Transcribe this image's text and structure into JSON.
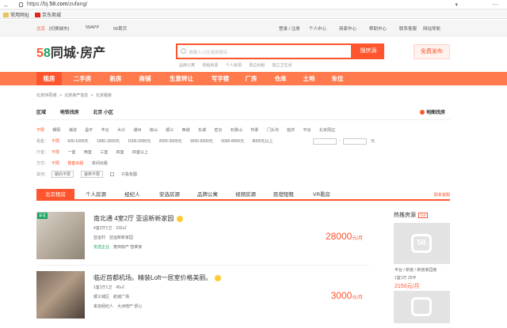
{
  "browser": {
    "url_prefix": "https://bj.",
    "url_domain": "58.com",
    "url_path": "/zufang/",
    "bookmarks": [
      "常用网址",
      "京东商城"
    ]
  },
  "topbar": {
    "city": "北京",
    "switch_city": "[切换城市]",
    "app": "58APP",
    "home": "58首页",
    "login": "登录 / 注册",
    "personal": "个人中心",
    "merchant": "商家中心",
    "help": "帮助中心",
    "service": "联系客服",
    "sitenav": "网站导航"
  },
  "header": {
    "logo_5": "5",
    "logo_8": "8",
    "logo_rest": "同城·房产",
    "search_placeholder": "请输入小区或商圈名",
    "search_button": "搜房源",
    "publish_button": "免费发布",
    "hot_keywords": [
      "品牌公寓",
      "热租房源",
      "个人房源",
      "周边出租",
      "独立卫生间"
    ]
  },
  "mainnav": [
    "租房",
    "二手房",
    "新房",
    "商铺",
    "生意转让",
    "写字楼",
    "厂房",
    "仓库",
    "土地",
    "车位"
  ],
  "breadcrumb": [
    "北京58同城",
    ">",
    "北京房产信息",
    ">",
    "北京租房"
  ],
  "areatabs": [
    "区域",
    "地铁找房",
    "北京 小区"
  ],
  "mapsearch": "地图找房",
  "filters": {
    "area": [
      "不限",
      "朝阳",
      "海淀",
      "昌平",
      "丰台",
      "大兴",
      "通州",
      "房山",
      "顺义",
      "西城",
      "东城",
      "密云",
      "石景山",
      "怀柔",
      "门头沟",
      "延庆",
      "平谷",
      "北京周边"
    ],
    "rent_label": "租金：",
    "rent": [
      "不限",
      "600-1000元",
      "1000-1500元",
      "1500-2000元",
      "2000-3000元",
      "3000-5000元",
      "5000-8000元",
      "8000元以上"
    ],
    "rent_unit": "元",
    "rooms_label": "厅室：",
    "rooms": [
      "不限",
      "一室",
      "两室",
      "三室",
      "四室",
      "四室以上"
    ],
    "type_label": "方式：",
    "type": [
      "不限",
      "整套出租",
      "单间出租"
    ],
    "other_label": "其他：",
    "other": [
      "朝向不限",
      "装修不限"
    ],
    "with_image": "只看有图"
  },
  "listtabs": {
    "tabs": [
      "北京租房",
      "个人房源",
      "经纪人",
      "安选房源",
      "品牌公寓",
      "视频房源",
      "民宿短租",
      "VR看房"
    ],
    "more": "联系客服"
  },
  "listings": [
    {
      "badge": "安选",
      "title": "南北通 4室2厅 亚运新新家园",
      "desc1": [
        "4室2厅2卫",
        "232㎡"
      ],
      "desc2": [
        "亚运村",
        "亚运新新家园"
      ],
      "desc3": [
        "安选企业",
        "麦田房产 智荣家"
      ],
      "price": "28000",
      "unit": "元/月"
    },
    {
      "badge": "",
      "title": "临近首都机场。精装Loft一居室价格美丽。",
      "desc1": [
        "1室1厅1卫",
        "45㎡"
      ],
      "desc2": [
        "顺义城区",
        "航城广场"
      ],
      "desc3": [
        "来自经纪人",
        "大洲地产 舒心"
      ],
      "price": "3000",
      "unit": "元/月"
    }
  ],
  "sidebar": {
    "title": "热推房源",
    "tag": "hot",
    "watermark": "58",
    "line1": "丰台 / 新宫 / 新宫家园南",
    "line2": "1室1厅    25平",
    "price": "2150元/月"
  }
}
